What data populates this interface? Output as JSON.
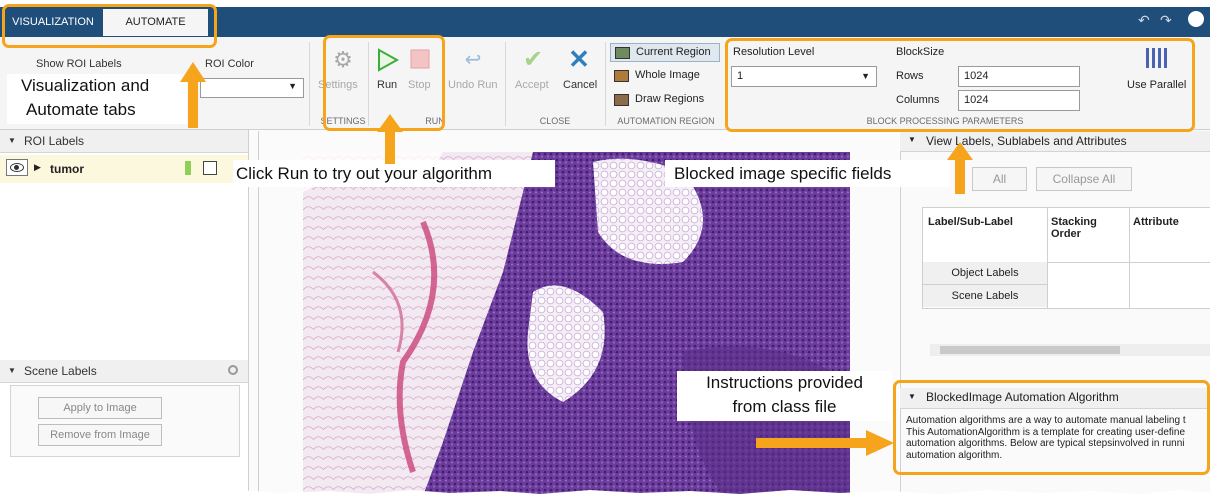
{
  "tabs": {
    "visualization": "VISUALIZATION",
    "automate": "AUTOMATE"
  },
  "roi": {
    "show_labels": "Show ROI Labels",
    "color": "ROI Color"
  },
  "settings_group": {
    "settings_label": "Settings",
    "group": "SETTINGS"
  },
  "run_group": {
    "run": "Run",
    "stop": "Stop",
    "undo": "Undo Run",
    "group": "RUN"
  },
  "close_group": {
    "accept": "Accept",
    "cancel": "Cancel",
    "group": "CLOSE"
  },
  "automation_region": {
    "current": "Current Region",
    "whole": "Whole Image",
    "draw": "Draw Regions",
    "group": "AUTOMATION REGION"
  },
  "block_params": {
    "resolution_label": "Resolution Level",
    "resolution_value": "1",
    "blocksize_label": "BlockSize",
    "rows_label": "Rows",
    "rows_value": "1024",
    "columns_label": "Columns",
    "columns_value": "1024",
    "use_parallel": "Use Parallel",
    "group": "BLOCK PROCESSING PARAMETERS"
  },
  "left_panel": {
    "roi_labels_header": "ROI Labels",
    "label_name": "tumor",
    "label_color": "#8fcf57",
    "scene_labels_header": "Scene Labels",
    "apply_button": "Apply to Image",
    "remove_button": "Remove from Image"
  },
  "right_panel": {
    "view_header": "View Labels, Sublabels and Attributes",
    "expand_all": "All",
    "collapse_all": "Collapse All",
    "table_headers": [
      "Label/Sub-Label",
      "Stacking Order",
      "Attribute"
    ],
    "table_rows": [
      "Object Labels",
      "Scene Labels"
    ],
    "algo_header": "BlockedImage Automation Algorithm",
    "algo_lines": [
      "Automation algorithms are a way to automate manual labeling t",
      "This AutomationAlgorithm is a template for creating user-define",
      "automation algorithms. Below are typical stepsinvolved in runni",
      "automation algorithm."
    ]
  },
  "callouts": {
    "tabs_line1": "Visualization and",
    "tabs_line2": "Automate tabs",
    "run": "Click Run to try out your algorithm",
    "blocked": "Blocked image specific fields",
    "instr_line1": "Instructions provided",
    "instr_line2": "from class file"
  },
  "colors": {
    "accent": "#f5a41b",
    "titlebar": "#1f4e7b",
    "run": "#3cae3c",
    "stop": "#e8a0a0",
    "accept": "#a6d38a",
    "cancel": "#2f7fbf"
  }
}
